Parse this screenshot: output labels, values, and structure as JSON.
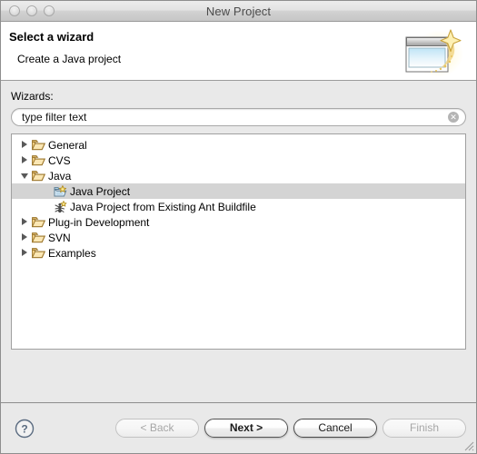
{
  "window": {
    "title": "New Project",
    "traffic_lights": [
      "close-button",
      "minimize-button",
      "zoom-button"
    ]
  },
  "header": {
    "title": "Select a wizard",
    "description": "Create a Java project",
    "icon": "new-project-wizard-icon"
  },
  "content": {
    "wizards_label": "Wizards:",
    "filter": {
      "value": "type filter text",
      "placeholder": "type filter text",
      "clear_icon": "clear-icon",
      "clear_glyph": "✕"
    }
  },
  "tree": {
    "rows": [
      {
        "label": "General",
        "icon": "folder-icon",
        "state": "closed",
        "indent": 0,
        "selected": false
      },
      {
        "label": "CVS",
        "icon": "folder-icon",
        "state": "closed",
        "indent": 0,
        "selected": false
      },
      {
        "label": "Java",
        "icon": "folder-icon",
        "state": "open",
        "indent": 0,
        "selected": false
      },
      {
        "label": "Java Project",
        "icon": "java-project-icon",
        "state": "leaf",
        "indent": 1,
        "selected": true
      },
      {
        "label": "Java Project from Existing Ant Buildfile",
        "icon": "ant-icon",
        "state": "leaf",
        "indent": 1,
        "selected": false
      },
      {
        "label": "Plug-in Development",
        "icon": "folder-icon",
        "state": "closed",
        "indent": 0,
        "selected": false
      },
      {
        "label": "SVN",
        "icon": "folder-icon",
        "state": "closed",
        "indent": 0,
        "selected": false
      },
      {
        "label": "Examples",
        "icon": "folder-icon",
        "state": "closed",
        "indent": 0,
        "selected": false
      }
    ]
  },
  "buttons": {
    "help": {
      "label": "?",
      "name": "help-button"
    },
    "back": {
      "label": "< Back",
      "enabled": false,
      "default": false
    },
    "next": {
      "label": "Next >",
      "enabled": true,
      "default": true
    },
    "cancel": {
      "label": "Cancel",
      "enabled": true,
      "default": false
    },
    "finish": {
      "label": "Finish",
      "enabled": false,
      "default": false
    }
  },
  "colors": {
    "window_bg": "#e9e9e9",
    "titlebar_top": "#ececec",
    "titlebar_bottom": "#c6c6c6",
    "header_bg": "#ffffff",
    "selection": "#d4d4d4",
    "folder": "#f5c86a",
    "folder_outline": "#9a7428",
    "text": "#000000",
    "disabled_text": "#a6a6a6"
  }
}
